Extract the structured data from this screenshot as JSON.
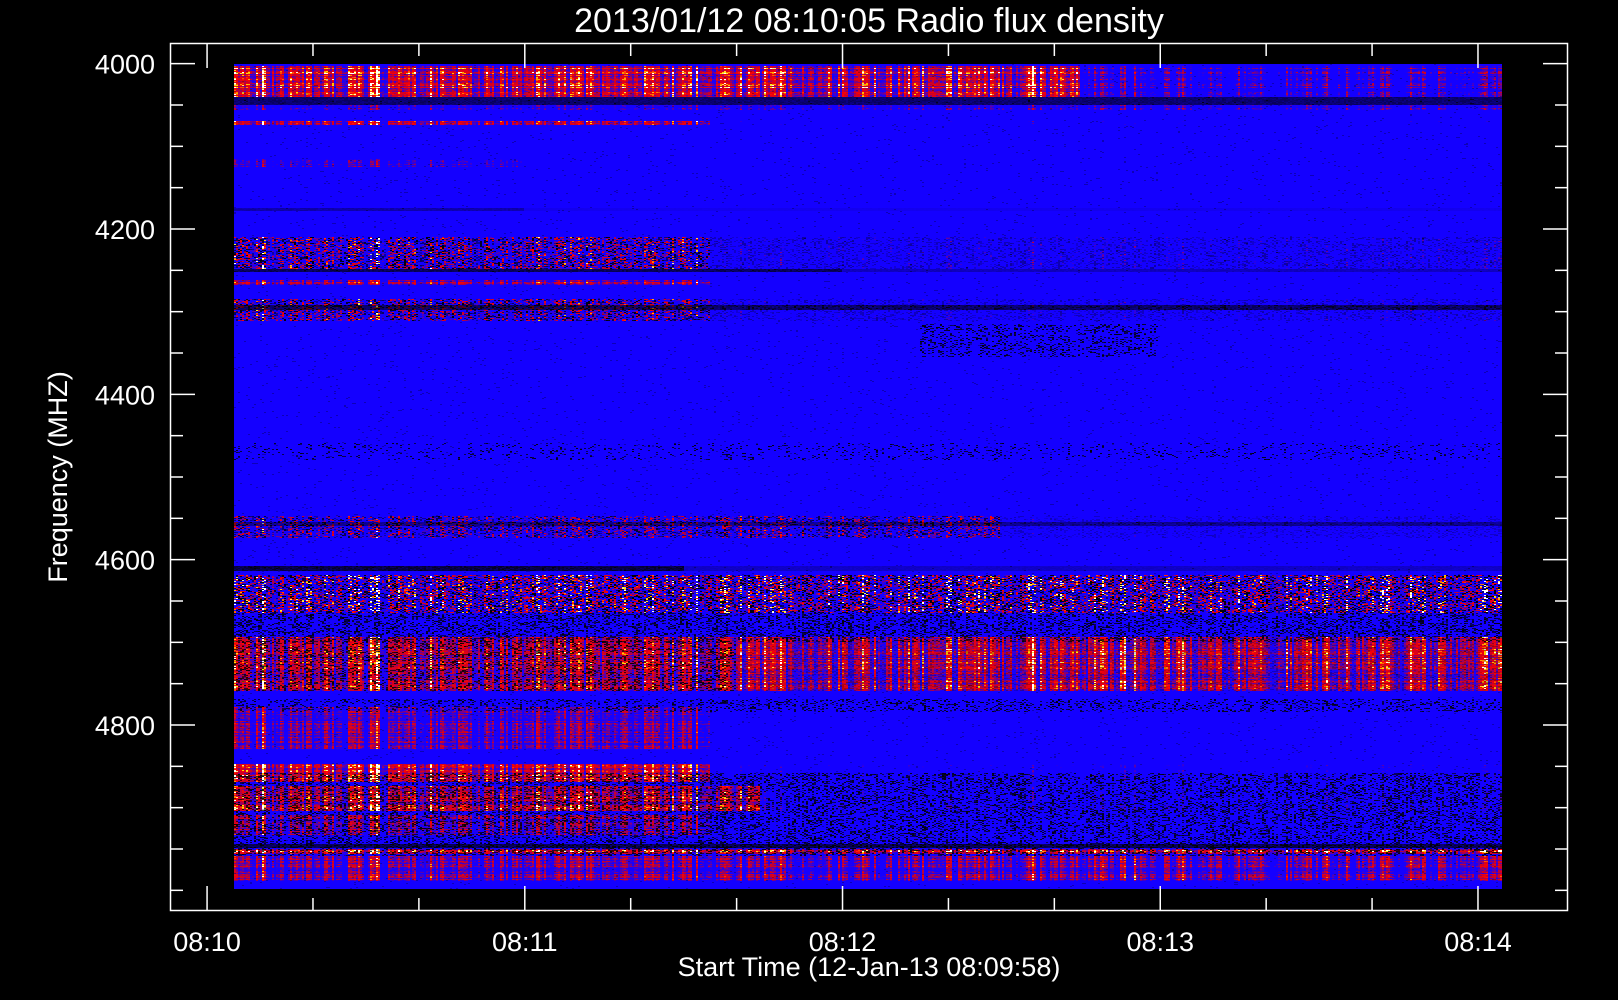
{
  "chart_data": {
    "type": "heatmap",
    "title": "2013/01/12 08:10:05 Radio flux density",
    "xlabel": "Start Time (12-Jan-13 08:09:58)",
    "ylabel": "Frequency (MHZ)",
    "x_axis": {
      "type": "time",
      "range": [
        "08:09:53",
        "08:14:17"
      ],
      "major_ticks": [
        "08:10",
        "08:11",
        "08:12",
        "08:13",
        "08:14"
      ],
      "minor_tick_interval_s": 20
    },
    "y_axis": {
      "range": [
        3975,
        5025
      ],
      "inverted": true,
      "major_ticks": [
        4000,
        4200,
        4400,
        4600,
        4800
      ],
      "minor_tick_interval": 50
    },
    "data_extent": {
      "time": [
        "08:10:05",
        "08:14:05"
      ],
      "frequency": [
        4000,
        5000
      ]
    },
    "colormap": [
      "#000000",
      "#1400ff",
      "#ff0000",
      "#ffdc00",
      "#ffffff"
    ],
    "background_level_color": "#1400ff",
    "grid": false,
    "bands": [
      {
        "f": [
          4003,
          4040
        ],
        "kind": "red",
        "strength": 0.95,
        "until": "08:12:45",
        "after": 0.45
      },
      {
        "f": [
          4040,
          4050
        ],
        "kind": "dark",
        "strength": 0.7,
        "until": "08:14:05",
        "after": 1
      },
      {
        "f": [
          4050,
          4056
        ],
        "kind": "red",
        "strength": 0.35,
        "until": "08:14:05",
        "after": 1
      },
      {
        "f": [
          4069,
          4074
        ],
        "kind": "red",
        "strength": 0.9,
        "until": "08:11:35",
        "after": 0.25
      },
      {
        "f": [
          4115,
          4125
        ],
        "kind": "red",
        "strength": 0.4,
        "until": "08:11:00",
        "after": 0.1
      },
      {
        "f": [
          4175,
          4178
        ],
        "kind": "dark",
        "strength": 0.4,
        "until": "08:11:00",
        "after": 0.2
      },
      {
        "f": [
          4210,
          4248
        ],
        "kind": "speckle",
        "strength": 0.75,
        "until": "08:11:35",
        "after": 0.35
      },
      {
        "f": [
          4248,
          4252
        ],
        "kind": "dark",
        "strength": 0.8,
        "until": "08:12:00",
        "after": 0.4
      },
      {
        "f": [
          4262,
          4268
        ],
        "kind": "red",
        "strength": 0.7,
        "until": "08:11:35",
        "after": 0.1
      },
      {
        "f": [
          4285,
          4312
        ],
        "kind": "speckle",
        "strength": 0.7,
        "until": "08:11:35",
        "after": 0.35
      },
      {
        "f": [
          4292,
          4298
        ],
        "kind": "dark",
        "strength": 0.7,
        "until": "08:14:05",
        "after": 1
      },
      {
        "f": [
          4315,
          4355
        ],
        "kind": "speckle-dark",
        "strength": 0.5,
        "from": "08:12:15",
        "until": "08:13:00",
        "after": 0
      },
      {
        "f": [
          4460,
          4480
        ],
        "kind": "speckle-dark",
        "strength": 0.2,
        "until": "08:14:05",
        "after": 1
      },
      {
        "f": [
          4548,
          4575
        ],
        "kind": "speckle",
        "strength": 0.6,
        "until": "08:12:30",
        "after": 0.3
      },
      {
        "f": [
          4555,
          4560
        ],
        "kind": "dark",
        "strength": 0.5,
        "until": "08:14:05",
        "after": 1
      },
      {
        "f": [
          4608,
          4615
        ],
        "kind": "dark",
        "strength": 0.9,
        "until": "08:11:30",
        "after": 0.3
      },
      {
        "f": [
          4620,
          4665
        ],
        "kind": "speckle",
        "strength": 0.95,
        "until": "08:14:05",
        "after": 1
      },
      {
        "f": [
          4665,
          4700
        ],
        "kind": "speckle-dark",
        "strength": 0.7,
        "until": "08:14:05",
        "after": 0.8
      },
      {
        "f": [
          4695,
          4760
        ],
        "kind": "red",
        "strength": 0.8,
        "until": "08:14:05",
        "after": 1
      },
      {
        "f": [
          4700,
          4760
        ],
        "kind": "speckle-dark",
        "strength": 0.6,
        "until": "08:11:40",
        "after": 0.3
      },
      {
        "f": [
          4770,
          4785
        ],
        "kind": "speckle-dark",
        "strength": 0.5,
        "until": "08:14:05",
        "after": 0.7
      },
      {
        "f": [
          4780,
          4830
        ],
        "kind": "red",
        "strength": 0.55,
        "until": "08:11:35",
        "after": 0.2
      },
      {
        "f": [
          4848,
          4870
        ],
        "kind": "red",
        "strength": 0.95,
        "until": "08:11:35",
        "after": 0.25
      },
      {
        "f": [
          4860,
          4960
        ],
        "kind": "speckle-dark",
        "strength": 0.65,
        "until": "08:14:05",
        "after": 1
      },
      {
        "f": [
          4875,
          4905
        ],
        "kind": "red",
        "strength": 0.85,
        "until": "08:11:45",
        "after": 0.3
      },
      {
        "f": [
          4910,
          4935
        ],
        "kind": "red",
        "strength": 0.6,
        "until": "08:11:35",
        "after": 0.25
      },
      {
        "f": [
          4945,
          4950
        ],
        "kind": "dark",
        "strength": 0.8,
        "until": "08:14:05",
        "after": 1
      },
      {
        "f": [
          4952,
          4957
        ],
        "kind": "red",
        "strength": 1.0,
        "until": "08:14:05",
        "after": 1
      },
      {
        "f": [
          4960,
          4990
        ],
        "kind": "red",
        "strength": 0.6,
        "until": "08:14:05",
        "after": 0.85
      }
    ]
  }
}
